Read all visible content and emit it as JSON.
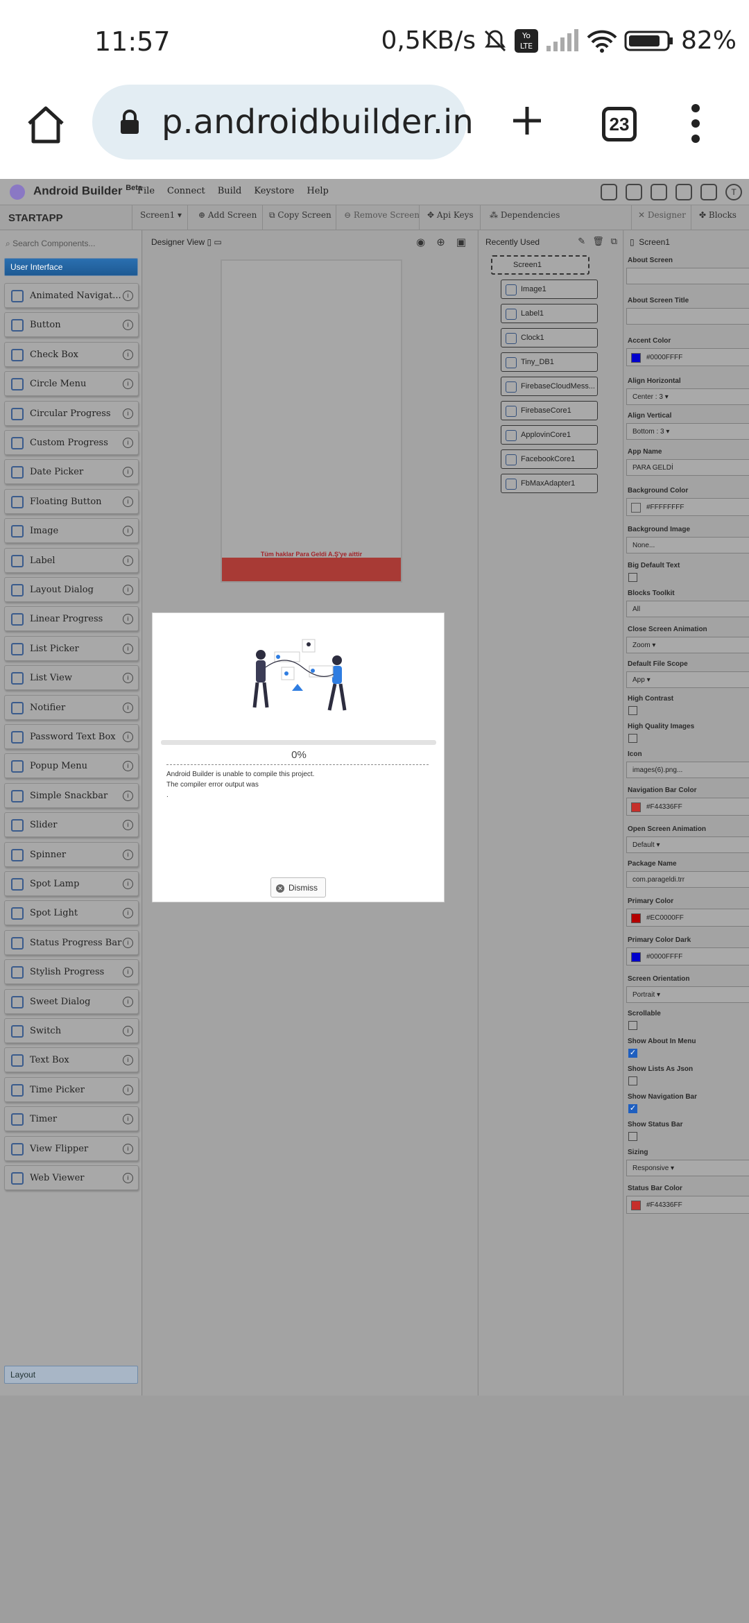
{
  "status": {
    "time": "11:57",
    "speed": "0,5KB/s",
    "battery": "82%"
  },
  "browser": {
    "url": "p.androidbuilder.in",
    "tab_count": "23"
  },
  "app": {
    "brand": "Android Builder",
    "brand_badge": "Beta",
    "menu": [
      "File",
      "Connect",
      "Build",
      "Keystore",
      "Help"
    ],
    "avatar_letter": "T"
  },
  "toolbar": {
    "project": "STARTAPP",
    "screen": "Screen1 ▾",
    "add_screen": "Add Screen",
    "copy_screen": "Copy Screen",
    "remove_screen": "Remove Screen",
    "api_keys": "Api Keys",
    "dependencies": "Dependencies",
    "designer": "Designer",
    "blocks": "Blocks"
  },
  "palette": {
    "search_placeholder": "Search Components...",
    "category_ui": "User Interface",
    "category_layout": "Layout",
    "items": [
      "Animated Navigat...",
      "Button",
      "Check Box",
      "Circle Menu",
      "Circular Progress",
      "Custom Progress",
      "Date Picker",
      "Floating Button",
      "Image",
      "Label",
      "Layout Dialog",
      "Linear Progress",
      "List Picker",
      "List View",
      "Notifier",
      "Password Text Box",
      "Popup Menu",
      "Simple Snackbar",
      "Slider",
      "Spinner",
      "Spot Lamp",
      "Spot Light",
      "Status Progress Bar",
      "Stylish Progress",
      "Sweet Dialog",
      "Switch",
      "Text Box",
      "Time Picker",
      "Timer",
      "View Flipper",
      "Web Viewer"
    ]
  },
  "designer": {
    "label": "Designer View",
    "footer_text": "Tüm haklar Para Geldi A.Ş'ye aittir"
  },
  "outline": {
    "recent": "Recently Used",
    "screen": "Screen1",
    "items": [
      "Image1",
      "Label1",
      "Clock1",
      "Tiny_DB1",
      "FirebaseCloudMess...",
      "FirebaseCore1",
      "ApplovinCore1",
      "FacebookCore1",
      "FbMaxAdapter1"
    ]
  },
  "properties": {
    "header": "Screen1",
    "about_screen": "About Screen",
    "about_screen_title": "About Screen Title",
    "accent_color": "Accent Color",
    "accent_color_val": "#0000FFFF",
    "accent_color_hex": "#0000cc",
    "align_h": "Align Horizontal",
    "align_h_val": "Center : 3 ▾",
    "align_v": "Align Vertical",
    "align_v_val": "Bottom : 3 ▾",
    "app_name": "App Name",
    "app_name_val": "PARA GELDİ",
    "bg_color": "Background Color",
    "bg_color_val": "#FFFFFFFF",
    "bg_image": "Background Image",
    "bg_image_val": "None...",
    "big_default": "Big Default Text",
    "blocks_toolkit": "Blocks Toolkit",
    "blocks_toolkit_val": "All",
    "close_anim": "Close Screen Animation",
    "close_anim_val": "Zoom ▾",
    "file_scope": "Default File Scope",
    "file_scope_val": "App ▾",
    "high_contrast": "High Contrast",
    "hq_images": "High Quality Images",
    "icon": "Icon",
    "icon_val": "images(6).png...",
    "nav_color": "Navigation Bar Color",
    "nav_color_val": "#F44336FF",
    "nav_color_hex": "#c62f2a",
    "open_anim": "Open Screen Animation",
    "open_anim_val": "Default ▾",
    "package": "Package Name",
    "package_val": "com.parageldi.trr",
    "primary": "Primary Color",
    "primary_val": "#EC0000FF",
    "primary_hex": "#b40000",
    "primary_dark": "Primary Color Dark",
    "primary_dark_val": "#0000FFFF",
    "primary_dark_hex": "#0000cc",
    "orientation": "Screen Orientation",
    "orientation_val": "Portrait ▾",
    "scrollable": "Scrollable",
    "show_about": "Show About In Menu",
    "show_lists": "Show Lists As Json",
    "show_nav": "Show Navigation Bar",
    "show_status": "Show Status Bar",
    "sizing": "Sizing",
    "sizing_val": "Responsive ▾",
    "status_color": "Status Bar Color",
    "status_color_val": "#F44336FF",
    "status_color_hex": "#c62f2a"
  },
  "dialog": {
    "progress_pct": "0%",
    "progress_fraction": 0,
    "line1": "Android Builder is unable to compile this project.",
    "line2": "The compiler error output was",
    "line3": ".",
    "dismiss": "Dismiss"
  }
}
